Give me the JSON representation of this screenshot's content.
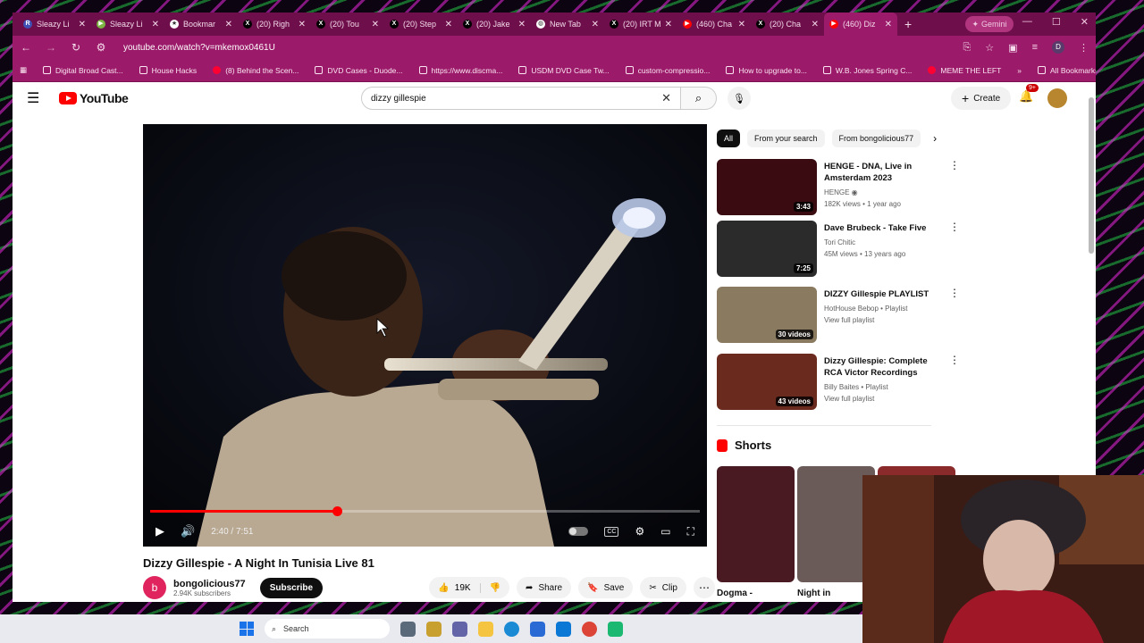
{
  "browser": {
    "tabs": [
      {
        "label": "Sleazy Li",
        "color": "#3f51b5",
        "glyph": "R"
      },
      {
        "label": "Sleazy Li",
        "color": "#7cb342",
        "glyph": "▶"
      },
      {
        "label": "Bookmar",
        "color": "#ffffff",
        "glyph": "★"
      },
      {
        "label": "(20) Righ",
        "color": "#000000",
        "glyph": "X"
      },
      {
        "label": "(20) Tou",
        "color": "#000000",
        "glyph": "X"
      },
      {
        "label": "(20) Step",
        "color": "#000000",
        "glyph": "X"
      },
      {
        "label": "(20) Jake",
        "color": "#000000",
        "glyph": "X"
      },
      {
        "label": "New Tab",
        "color": "#ffffff",
        "glyph": "◍"
      },
      {
        "label": "(20) IRT M",
        "color": "#000000",
        "glyph": "X"
      },
      {
        "label": "(460) Cha",
        "color": "#ff0000",
        "glyph": "▶"
      },
      {
        "label": "(20) Cha",
        "color": "#000000",
        "glyph": "X"
      },
      {
        "label": "(460) Diz",
        "color": "#ff0000",
        "glyph": "▶"
      }
    ],
    "gemini_label": "Gemini",
    "url": "youtube.com/watch?v=mkemox0461U",
    "bookmarks": [
      {
        "label": "Digital Broad Cast...",
        "type": "folder"
      },
      {
        "label": "House Hacks",
        "type": "folder"
      },
      {
        "label": "(8) Behind the Scen...",
        "type": "yt"
      },
      {
        "label": "DVD Cases - Duode...",
        "type": "site"
      },
      {
        "label": "https://www.discma...",
        "type": "site"
      },
      {
        "label": "USDM DVD Case Tw...",
        "type": "site"
      },
      {
        "label": "custom-compressio...",
        "type": "site"
      },
      {
        "label": "How to upgrade to...",
        "type": "site"
      },
      {
        "label": "W.B. Jones Spring C...",
        "type": "site"
      },
      {
        "label": "MEME THE LEFT",
        "type": "yt"
      }
    ],
    "all_bookmarks": "All Bookmarks"
  },
  "youtube": {
    "logo": "YouTube",
    "search_query": "dizzy gillespie",
    "create_label": "Create",
    "notif_badge": "9+"
  },
  "player": {
    "time": "2:40 / 7:51",
    "progress_fraction": 0.34
  },
  "video": {
    "title": "Dizzy Gillespie - A Night In Tunisia Live 81",
    "channel": "bongolicious77",
    "channel_initial": "b",
    "subscribers": "2.94K subscribers",
    "subscribe_label": "Subscribe",
    "likes": "19K",
    "share_label": "Share",
    "save_label": "Save",
    "clip_label": "Clip"
  },
  "chips": [
    "All",
    "From your search",
    "From bongolicious77"
  ],
  "recommendations": [
    {
      "title": "HENGE - DNA, Live in Amsterdam 2023",
      "channel": "HENGE ◉",
      "meta": "182K views • 1 year ago",
      "badge": "3:43",
      "thumb": "#3a0c12"
    },
    {
      "title": "Dave Brubeck - Take Five",
      "channel": "Tori Chitic",
      "meta": "45M views • 13 years ago",
      "badge": "7:25",
      "thumb": "#2b2b2b"
    },
    {
      "title": "DIZZY Gillespie PLAYLIST",
      "channel": "HotHouse Bebop • Playlist",
      "meta": "View full playlist",
      "badge": "30 videos",
      "thumb": "#8a7a60"
    },
    {
      "title": "Dizzy Gillespie: Complete RCA Victor Recordings",
      "channel": "Billy Baites • Playlist",
      "meta": "View full playlist",
      "badge": "43 videos",
      "thumb": "#6b2a1e"
    }
  ],
  "shorts": {
    "heading": "Shorts",
    "items": [
      {
        "title": "Dogma -",
        "color": "#4a1a22"
      },
      {
        "title": "Night in",
        "color": "#6a5a58"
      },
      {
        "title": "",
        "color": "#8a2a2a"
      }
    ]
  },
  "taskbar": {
    "search_label": "Search"
  }
}
